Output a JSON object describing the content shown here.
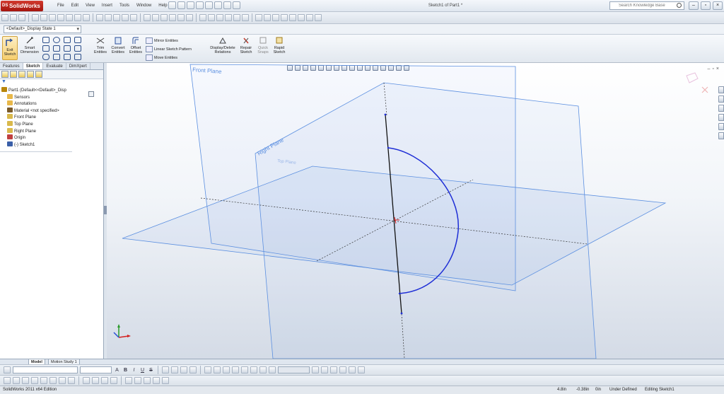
{
  "app": {
    "brand": "SolidWorks",
    "document_title": "Sketch1 of Part1 *",
    "menus": [
      "File",
      "Edit",
      "View",
      "Insert",
      "Tools",
      "Window",
      "Help"
    ],
    "search_placeholder": "Search Knowledge Base"
  },
  "window_controls": [
    "–",
    "▫",
    "×"
  ],
  "display_state": "<Default>_Display State 1",
  "command_manager": {
    "exit_sketch": "Exit Sketch",
    "smart_dimension": "Smart Dimension",
    "trim_entities": "Trim Entities",
    "convert_entities": "Convert Entities",
    "offset_entities": "Offset Entities",
    "mirror_entities": "Mirror Entities",
    "linear_sketch_pattern": "Linear Sketch Pattern",
    "move_entities": "Move Entities",
    "display_delete_relations": "Display/Delete Relations",
    "repair_sketch": "Repair Sketch",
    "quick_snaps": "Quick Snaps",
    "rapid_sketch": "Rapid Sketch"
  },
  "panel": {
    "tabs": [
      "Features",
      "Sketch",
      "Evaluate",
      "DimXpert"
    ],
    "active_tab": "Sketch",
    "tree": [
      {
        "label": "Part1  (Default<<Default>_Disp",
        "icon": "part-icon",
        "color": "#b8860b"
      },
      {
        "label": "Sensors",
        "icon": "sensor-folder-icon",
        "color": "#e8b84a"
      },
      {
        "label": "Annotations",
        "icon": "annotation-icon",
        "color": "#e8b84a"
      },
      {
        "label": "Material <not specified>",
        "icon": "material-icon",
        "color": "#7a5a2a"
      },
      {
        "label": "Front Plane",
        "icon": "plane-icon",
        "color": "#d9b94c"
      },
      {
        "label": "Top Plane",
        "icon": "plane-icon",
        "color": "#d9b94c"
      },
      {
        "label": "Right Plane",
        "icon": "plane-icon",
        "color": "#d9b94c"
      },
      {
        "label": "Origin",
        "icon": "origin-icon",
        "color": "#c04040"
      },
      {
        "label": "(-) Sketch1",
        "icon": "sketch-icon",
        "color": "#3a5fa8"
      }
    ]
  },
  "viewport": {
    "plane_labels": [
      "Front Plane",
      "Right Plane",
      "Top Plane"
    ],
    "plane_color": "#5b8fe0",
    "sketch_color": "#1f2fd6"
  },
  "model_tabs": [
    "Model",
    "Motion Study 1"
  ],
  "format_toolbar": [
    "A",
    "B",
    "I",
    "U",
    "S"
  ],
  "status": {
    "edition": "SolidWorks 2011 x64 Edition",
    "x": "4.8in",
    "y": "-0.38in",
    "z": "0in",
    "state": "Under Defined",
    "mode": "Editing Sketch1"
  }
}
